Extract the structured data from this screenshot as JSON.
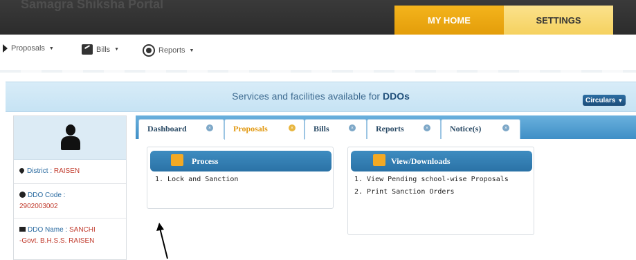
{
  "header": {
    "portal_title": "Samagra Shiksha Portal",
    "tabs": [
      {
        "label": "MY HOME"
      },
      {
        "label": "SETTINGS"
      }
    ]
  },
  "menu": {
    "items": [
      {
        "label": "Proposals",
        "icon": "arrow-right-icon"
      },
      {
        "label": "Bills",
        "icon": "bills-icon"
      },
      {
        "label": "Reports",
        "icon": "reports-icon"
      }
    ]
  },
  "banner": {
    "text_prefix": "Services and facilities available for ",
    "text_bold": "DDOs",
    "circulars_label": "Circulars"
  },
  "profile": {
    "district_label": "District : ",
    "district_value": "RAISEN",
    "ddo_code_label": "DDO Code :",
    "ddo_code_value": "2902003002",
    "ddo_name_label": "DDO Name : ",
    "ddo_name_value_1": "SANCHI",
    "ddo_name_value_2": "-Govt. B.H.S.S. RAISEN"
  },
  "tabs": [
    {
      "label": "Dashboard"
    },
    {
      "label": "Proposals"
    },
    {
      "label": "Bills"
    },
    {
      "label": "Reports"
    },
    {
      "label": "Notice(s)"
    }
  ],
  "process": {
    "title": "Process",
    "items": [
      "1. Lock and Sanction"
    ]
  },
  "downloads": {
    "title": "View/Downloads",
    "items": [
      "1. View Pending school-wise Proposals",
      "2. Print Sanction Orders"
    ]
  },
  "colors": {
    "accent_orange": "#f4b41c",
    "tab_blue": "#3f8fc6",
    "value_red": "#c0392b"
  }
}
